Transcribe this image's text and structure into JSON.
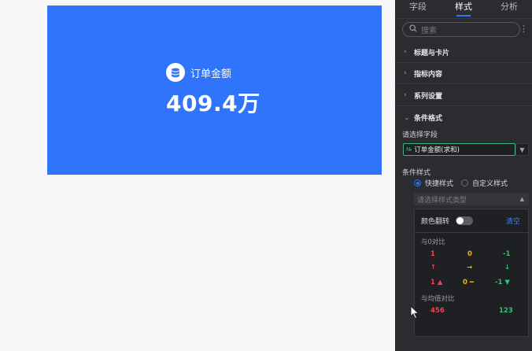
{
  "kpi_card": {
    "title": "订单金额",
    "value": "409.4万",
    "background": "#3074fb",
    "icon": "database-icon"
  },
  "panel": {
    "tabs": [
      "字段",
      "样式",
      "分析"
    ],
    "active_tab": "样式",
    "search_placeholder": "搜索",
    "sections": [
      "标题与卡片",
      "指标内容",
      "系列设置",
      "条件格式"
    ],
    "condition": {
      "field_label": "请选择字段",
      "field_tag": "№",
      "field_value": "订单金额(求和)",
      "style_label": "条件样式",
      "quick_style": "快捷样式",
      "custom_style": "自定义样式",
      "type_placeholder": "请选择样式类型"
    },
    "dropdown": {
      "invert_label": "颜色翻转",
      "clear_label": "清空",
      "compare_zero_label": "与0对比",
      "row_numbers": [
        "1",
        "0",
        "-1"
      ],
      "row_arrows": [
        "↑",
        "→",
        "↓"
      ],
      "row_mixed": [
        "1",
        "0",
        "-1"
      ],
      "compare_avg_label": "与均值对比",
      "avg_values": [
        "456",
        "123"
      ]
    }
  },
  "colors": {
    "accent": "#3074fb",
    "up": "#f0424f",
    "flat": "#f5b21c",
    "down": "#2fc46e"
  }
}
